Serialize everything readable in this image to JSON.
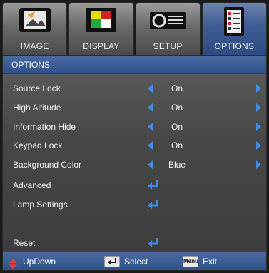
{
  "tabs": [
    {
      "label": "IMAGE",
      "icon": "image-icon",
      "active": false
    },
    {
      "label": "DISPLAY",
      "icon": "display-icon",
      "active": false
    },
    {
      "label": "SETUP",
      "icon": "setup-icon",
      "active": false
    },
    {
      "label": "OPTIONS",
      "icon": "options-icon",
      "active": true
    }
  ],
  "panel": {
    "title": "OPTIONS",
    "rows": [
      {
        "label": "Source Lock",
        "value": "On",
        "type": "selector"
      },
      {
        "label": "High Altitude",
        "value": "On",
        "type": "selector"
      },
      {
        "label": "Information Hide",
        "value": "On",
        "type": "selector"
      },
      {
        "label": "Keypad Lock",
        "value": "On",
        "type": "selector"
      },
      {
        "label": "Background Color",
        "value": "Blue",
        "type": "selector"
      },
      {
        "label": "Advanced",
        "type": "enter"
      },
      {
        "label": "Lamp Settings",
        "type": "enter"
      },
      {
        "label": "Reset",
        "type": "enter"
      }
    ]
  },
  "footer": {
    "updown_label": "UpDown",
    "select_label": "Select",
    "menu_key_label": "Menu",
    "exit_label": "Exit"
  },
  "colors": {
    "accent": "#3f8ce6",
    "header_blue": "#2f5089",
    "panel_gray": "#474747"
  }
}
